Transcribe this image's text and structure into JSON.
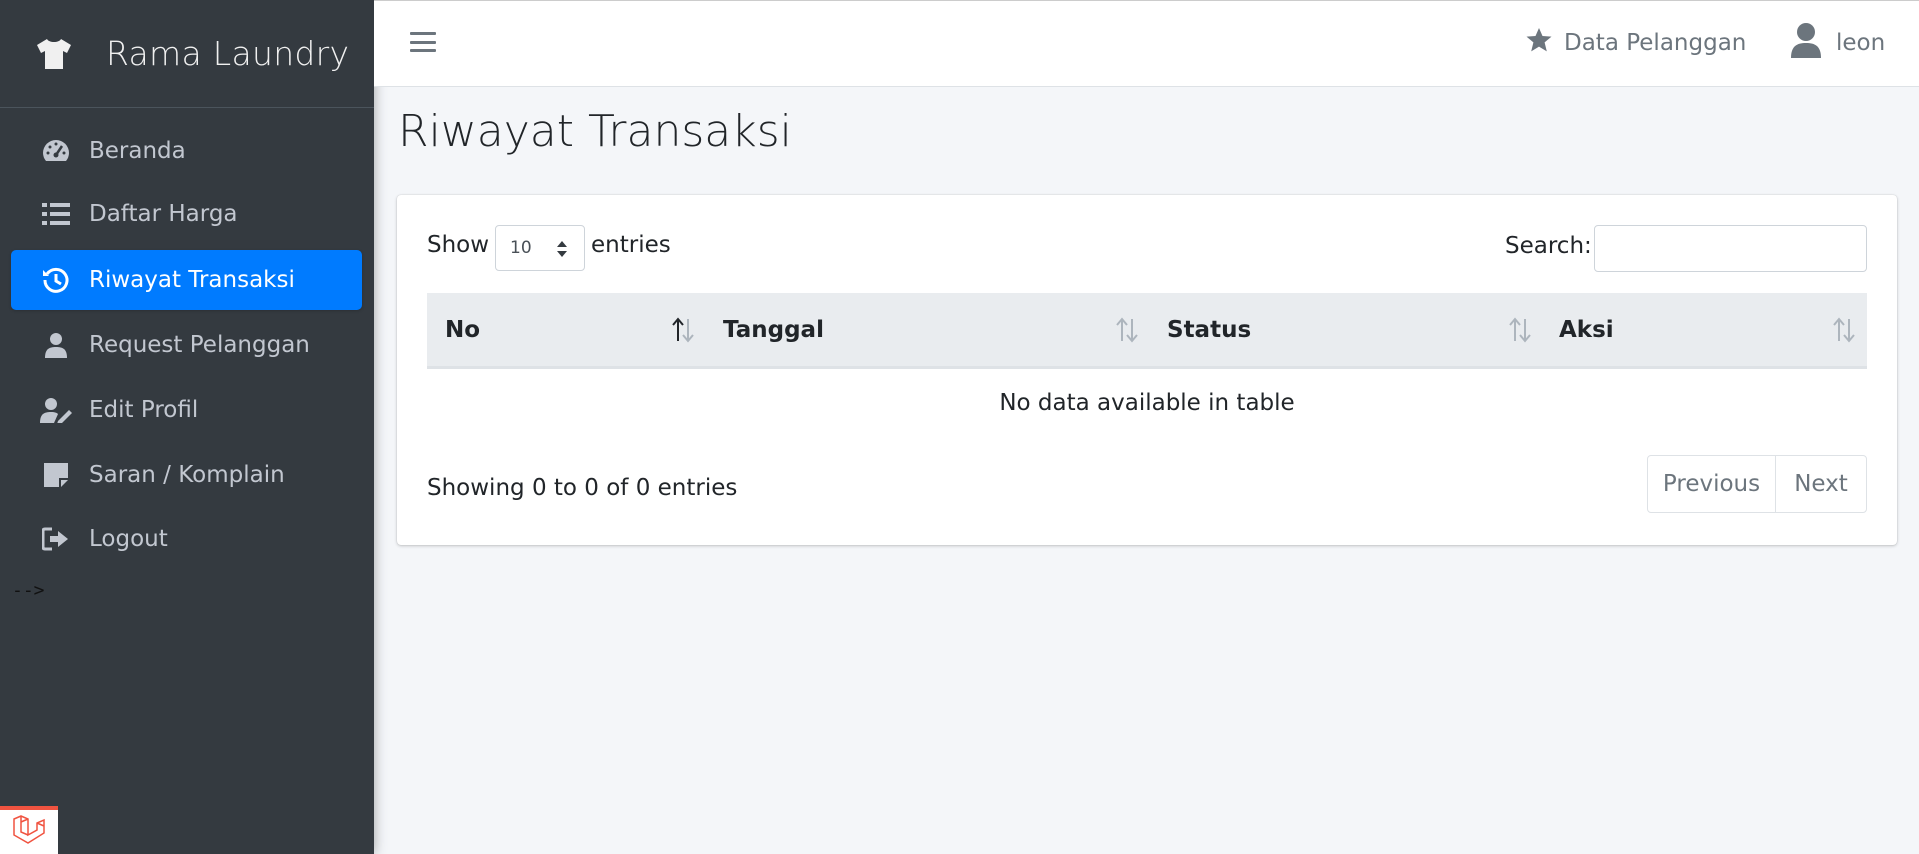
{
  "app": {
    "brand": "Rama Laundry"
  },
  "sidebar": {
    "items": [
      {
        "label": "Beranda",
        "icon": "tachometer-icon"
      },
      {
        "label": "Daftar Harga",
        "icon": "list-icon"
      },
      {
        "label": "Riwayat Transaksi",
        "icon": "history-icon",
        "active": true
      },
      {
        "label": "Request Pelanggan",
        "icon": "user-icon"
      },
      {
        "label": "Edit Profil",
        "icon": "user-edit-icon"
      },
      {
        "label": "Saran / Komplain",
        "icon": "sticky-note-icon"
      },
      {
        "label": "Logout",
        "icon": "sign-out-icon"
      }
    ],
    "stray_text": "-->"
  },
  "topbar": {
    "data_pelanggan": "Data Pelanggan",
    "user": "leon"
  },
  "main": {
    "title": "Riwayat Transaksi",
    "length": {
      "show": "Show",
      "value": "10",
      "entries": "entries"
    },
    "search": {
      "label": "Search:",
      "value": ""
    },
    "table": {
      "columns": [
        "No",
        "Tanggal",
        "Status",
        "Aksi"
      ],
      "empty_text": "No data available in table"
    },
    "info": "Showing 0 to 0 of 0 entries",
    "pagination": {
      "previous": "Previous",
      "next": "Next"
    }
  },
  "colors": {
    "sidebar": "#343a40",
    "active": "#007bff",
    "background": "#f4f6f9"
  }
}
